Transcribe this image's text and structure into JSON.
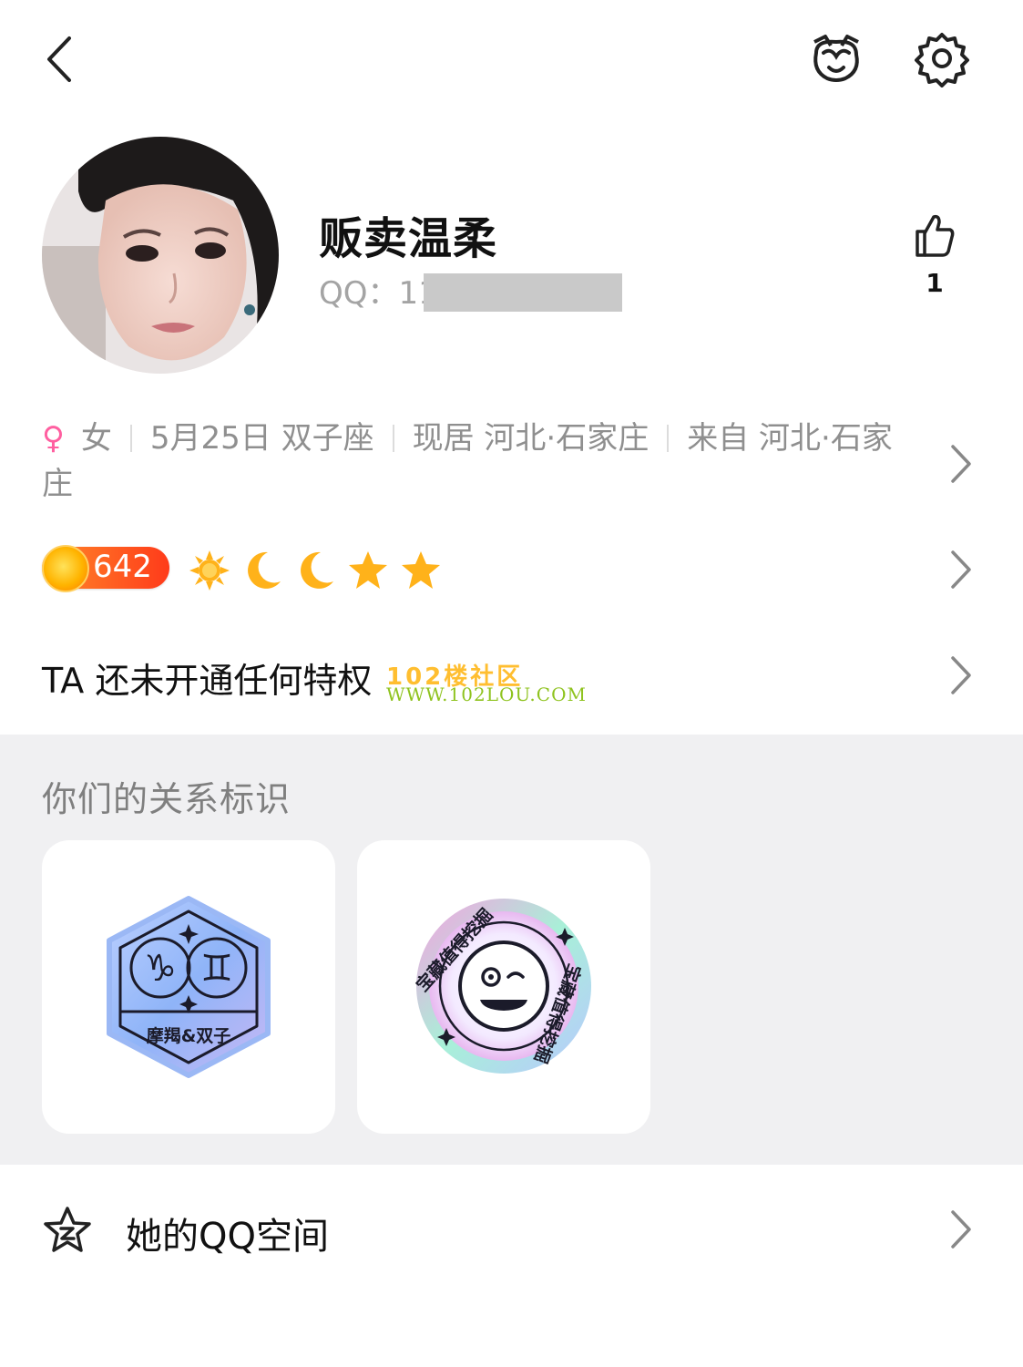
{
  "header": {
    "back_icon": "chevron-left-icon",
    "pet_icon": "pet-face-icon",
    "settings_icon": "gear-icon"
  },
  "profile": {
    "nickname": "贩卖温柔",
    "qq_label": "QQ：11",
    "like_count": "1"
  },
  "info": {
    "gender": "女",
    "birthday": "5月25日 双子座",
    "residence": "现居 河北·石家庄",
    "hometown": "来自 河北·石家庄"
  },
  "level": {
    "value": "642",
    "icons": [
      "sun-icon",
      "moon-icon",
      "moon-icon",
      "star-icon",
      "star-icon"
    ]
  },
  "privilege_text": "TA 还未开通任何特权",
  "watermark": {
    "line1": "102楼社区",
    "line2": "WWW.102LOU.COM"
  },
  "relations": {
    "title": "你们的关系标识",
    "badges": [
      {
        "label": "摩羯&双子"
      },
      {
        "label": "宝藏值得挖掘"
      }
    ]
  },
  "zone": {
    "label": "她的QQ空间"
  },
  "colors": {
    "accent_female": "#ff5fa0",
    "level_orange": "#ff5a1f",
    "section_gray": "#f0f0f2"
  }
}
